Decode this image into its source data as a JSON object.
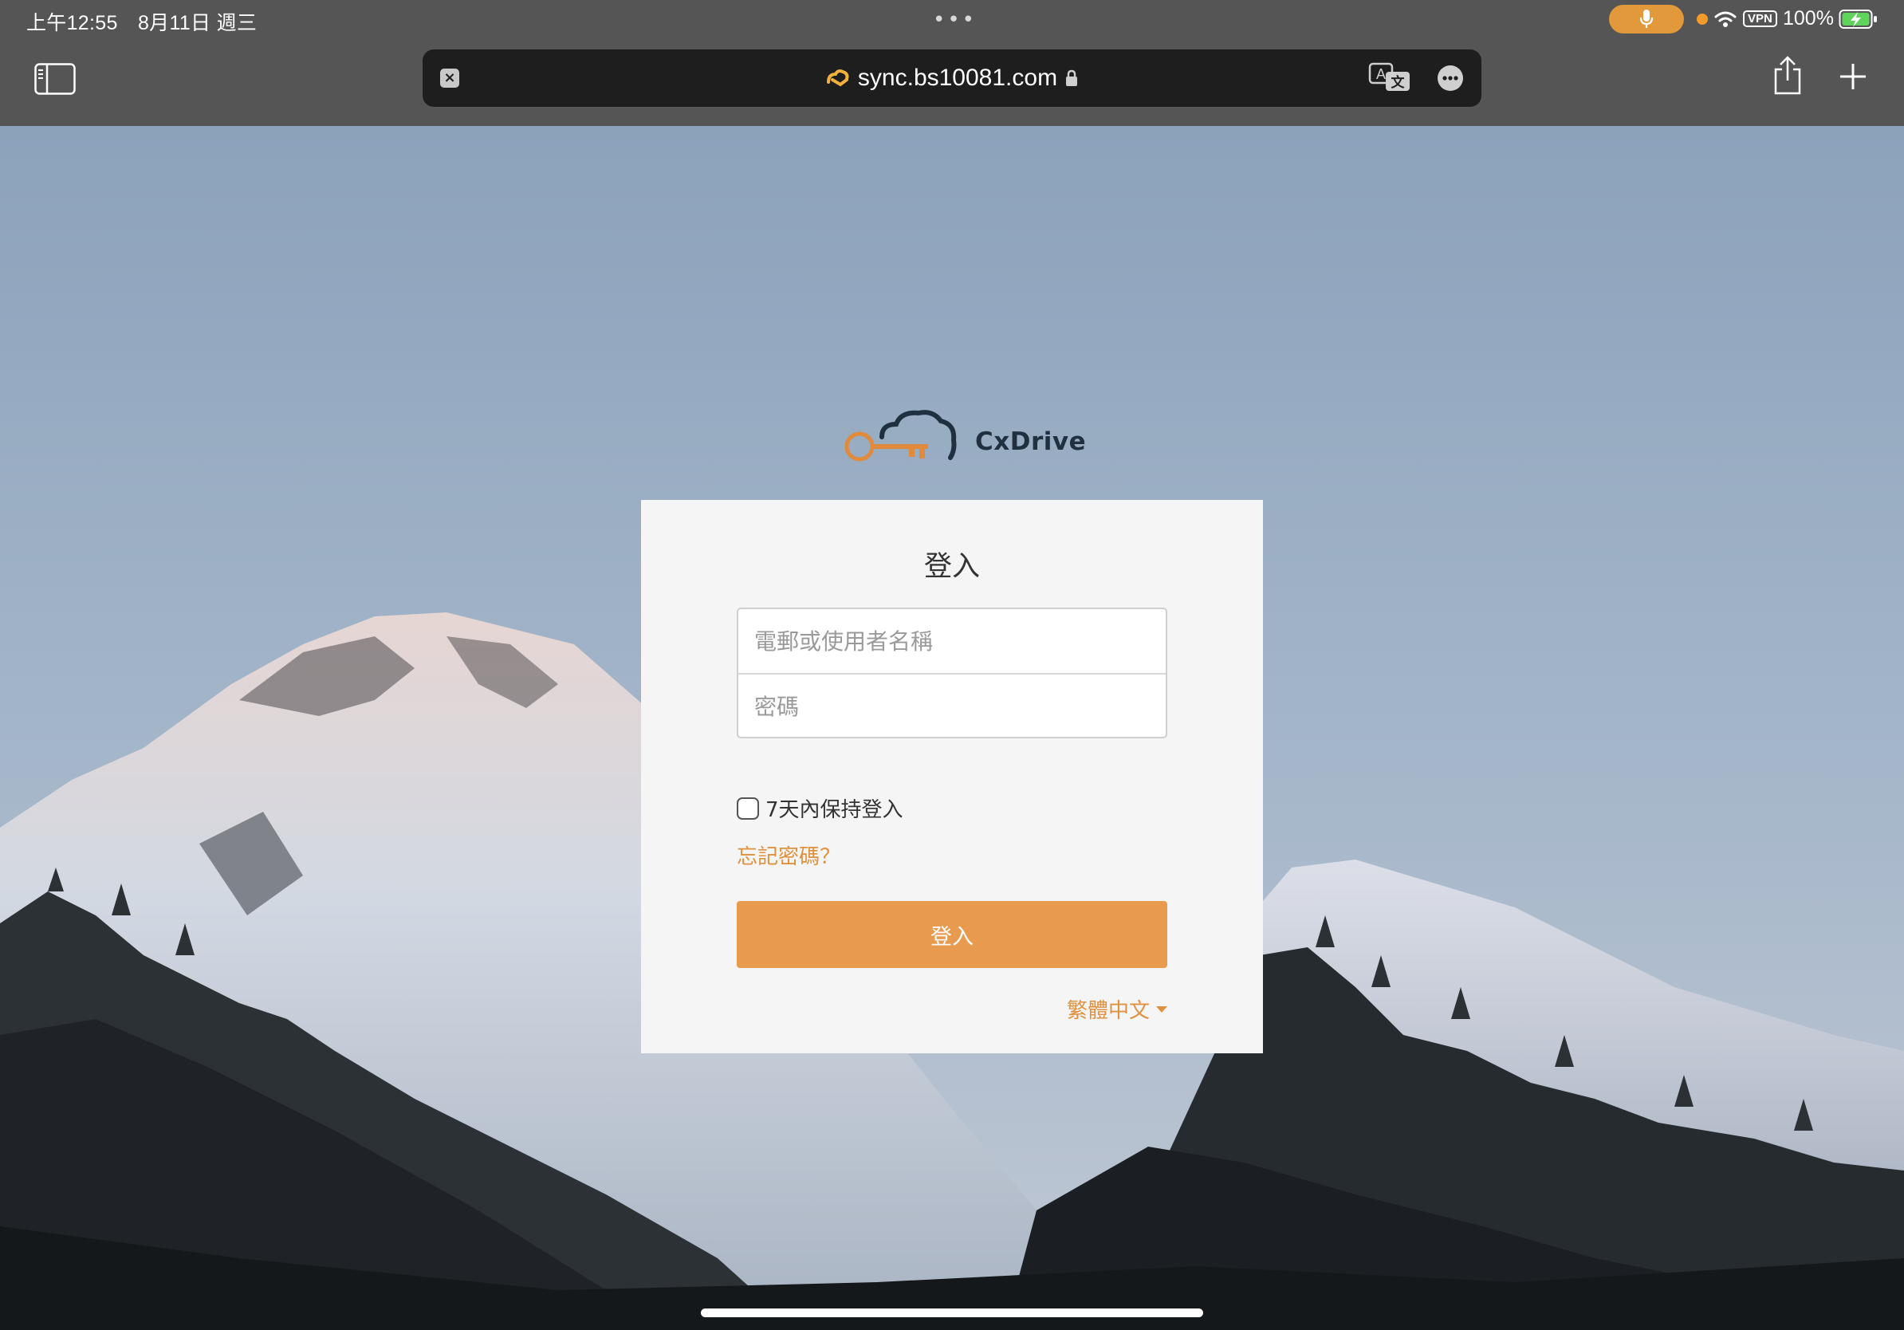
{
  "status_bar": {
    "time": "上午12:55　8月11日 週三",
    "battery": "100%",
    "vpn": "VPN",
    "icons": [
      "microphone-icon",
      "wifi-icon",
      "battery-charging-icon"
    ]
  },
  "browser": {
    "url": "sync.bs10081.com",
    "clear_label": "×",
    "icons": [
      "sidebar-icon",
      "site-icon",
      "lock-icon",
      "translate-icon",
      "more-icon",
      "share-icon",
      "plus-icon"
    ]
  },
  "login": {
    "brand": "CxDrive",
    "title": "登入",
    "username_placeholder": "電郵或使用者名稱",
    "password_placeholder": "密碼",
    "remember_label": "7天內保持登入",
    "forgot_label": "忘記密碼？",
    "submit_label": "登入",
    "language": "繁體中文"
  },
  "colors": {
    "accent": "#e89a4e",
    "link": "#e0913f",
    "chrome": "#555555",
    "url_bar": "#1e1e1e",
    "card": "#f5f5f5",
    "logo_dark": "#1f3140"
  }
}
